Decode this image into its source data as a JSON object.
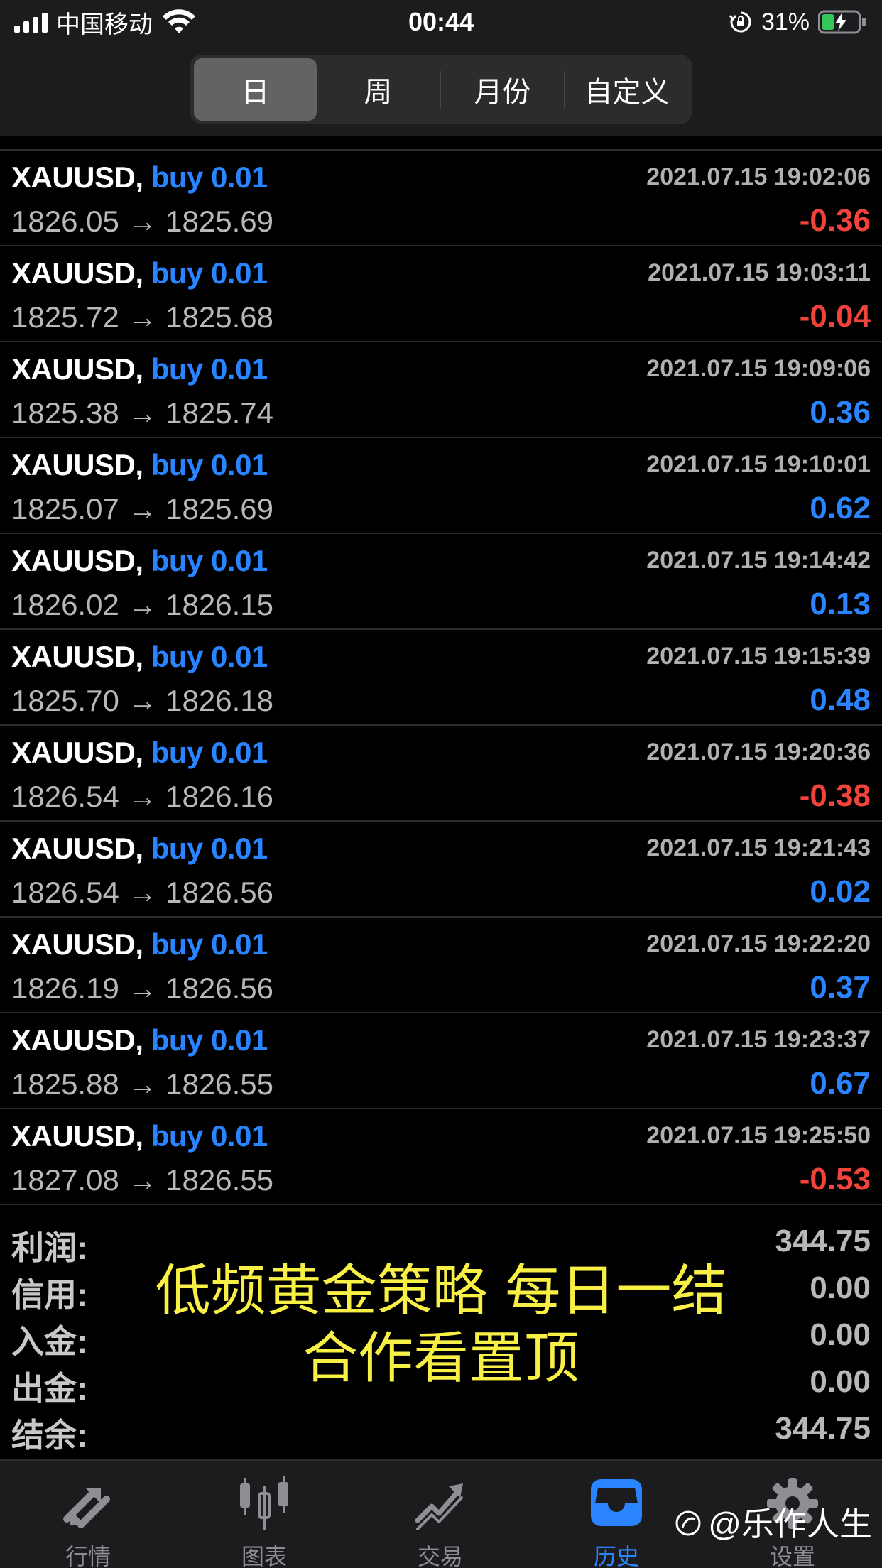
{
  "status_bar": {
    "carrier": "中国移动",
    "time": "00:44",
    "battery": "31%"
  },
  "period_tabs": [
    {
      "label": "日",
      "active": true
    },
    {
      "label": "周",
      "active": false
    },
    {
      "label": "月份",
      "active": false
    },
    {
      "label": "自定义",
      "active": false
    }
  ],
  "deals": [
    {
      "symbol": "XAUUSD,",
      "side": "buy 0.01",
      "time": "2021.07.15 19:02:06",
      "prices": "1826.05 → 1825.69",
      "profit": "-0.36"
    },
    {
      "symbol": "XAUUSD,",
      "side": "buy 0.01",
      "time": "2021.07.15 19:03:11",
      "prices": "1825.72 → 1825.68",
      "profit": "-0.04"
    },
    {
      "symbol": "XAUUSD,",
      "side": "buy 0.01",
      "time": "2021.07.15 19:09:06",
      "prices": "1825.38 → 1825.74",
      "profit": "0.36"
    },
    {
      "symbol": "XAUUSD,",
      "side": "buy 0.01",
      "time": "2021.07.15 19:10:01",
      "prices": "1825.07 → 1825.69",
      "profit": "0.62"
    },
    {
      "symbol": "XAUUSD,",
      "side": "buy 0.01",
      "time": "2021.07.15 19:14:42",
      "prices": "1826.02 → 1826.15",
      "profit": "0.13"
    },
    {
      "symbol": "XAUUSD,",
      "side": "buy 0.01",
      "time": "2021.07.15 19:15:39",
      "prices": "1825.70 → 1826.18",
      "profit": "0.48"
    },
    {
      "symbol": "XAUUSD,",
      "side": "buy 0.01",
      "time": "2021.07.15 19:20:36",
      "prices": "1826.54 → 1826.16",
      "profit": "-0.38"
    },
    {
      "symbol": "XAUUSD,",
      "side": "buy 0.01",
      "time": "2021.07.15 19:21:43",
      "prices": "1826.54 → 1826.56",
      "profit": "0.02"
    },
    {
      "symbol": "XAUUSD,",
      "side": "buy 0.01",
      "time": "2021.07.15 19:22:20",
      "prices": "1826.19 → 1826.56",
      "profit": "0.37"
    },
    {
      "symbol": "XAUUSD,",
      "side": "buy 0.01",
      "time": "2021.07.15 19:23:37",
      "prices": "1825.88 → 1826.55",
      "profit": "0.67"
    },
    {
      "symbol": "XAUUSD,",
      "side": "buy 0.01",
      "time": "2021.07.15 19:25:50",
      "prices": "1827.08 → 1826.55",
      "profit": "-0.53"
    }
  ],
  "summary": [
    {
      "label": "利润:",
      "value": "344.75"
    },
    {
      "label": "信用:",
      "value": "0.00"
    },
    {
      "label": "入金:",
      "value": "0.00"
    },
    {
      "label": "出金:",
      "value": "0.00"
    },
    {
      "label": "结余:",
      "value": "344.75"
    }
  ],
  "overlay_text": {
    "line1": "低频黄金策略 每日一结",
    "line2": "合作看置顶"
  },
  "tabbar": [
    {
      "label": "行情",
      "icon": "quotes-arrows-icon",
      "active": false
    },
    {
      "label": "图表",
      "icon": "candlestick-chart-icon",
      "active": false
    },
    {
      "label": "交易",
      "icon": "trade-trend-icon",
      "active": false
    },
    {
      "label": "历史",
      "icon": "history-inbox-icon",
      "active": true
    },
    {
      "label": "设置",
      "icon": "gear-icon",
      "active": false
    }
  ],
  "watermark": "@乐作人生",
  "colors": {
    "positive": "#2a84ff",
    "negative": "#f0433a",
    "overlay": "#f8f045",
    "active_tab": "#2a84ff"
  }
}
